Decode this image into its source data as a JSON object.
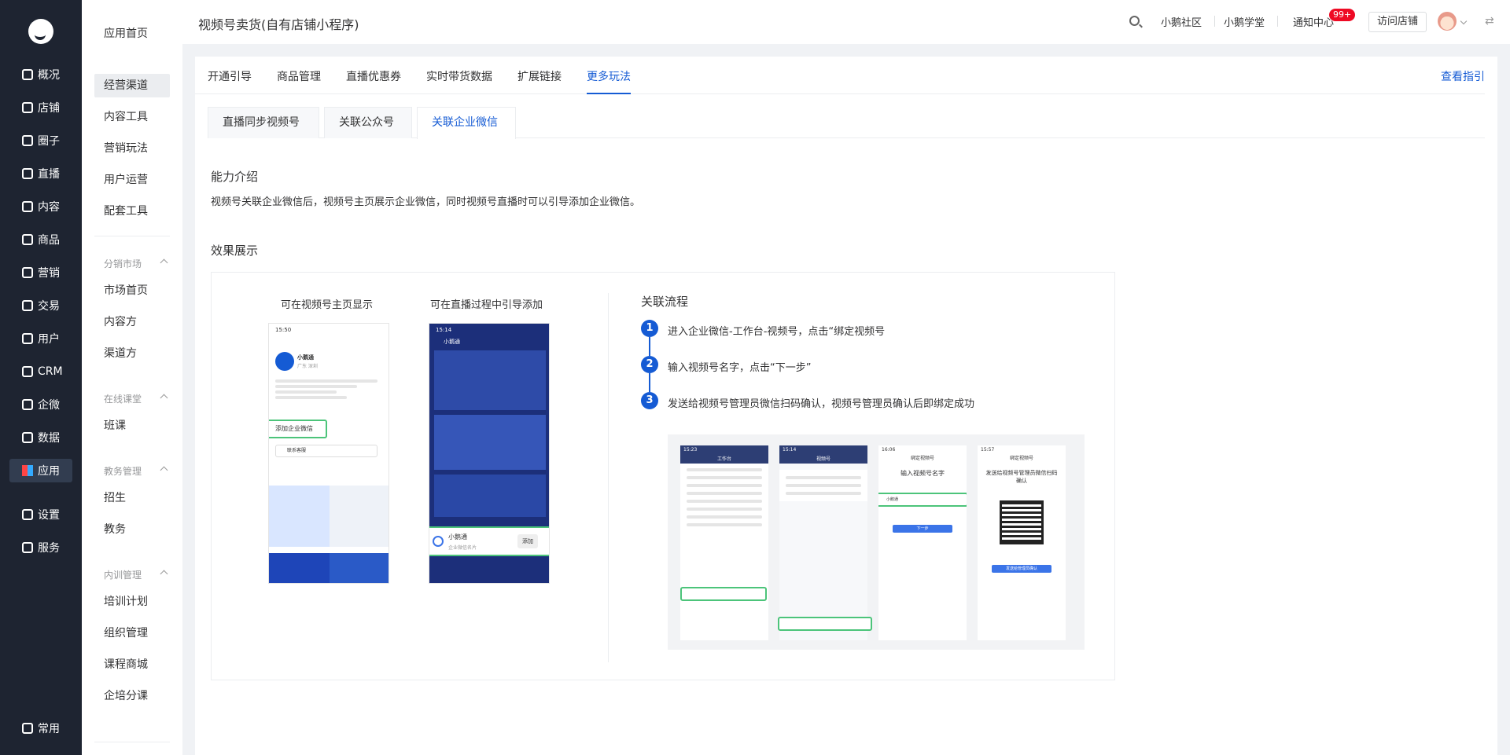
{
  "sidebar": {
    "items": [
      {
        "label": "概况",
        "icon": "overview-icon"
      },
      {
        "label": "店铺",
        "icon": "shop-icon"
      },
      {
        "label": "圈子",
        "icon": "circle-icon"
      },
      {
        "label": "直播",
        "icon": "live-icon"
      },
      {
        "label": "内容",
        "icon": "content-icon"
      },
      {
        "label": "商品",
        "icon": "goods-icon"
      },
      {
        "label": "营销",
        "icon": "marketing-icon"
      },
      {
        "label": "交易",
        "icon": "trade-icon"
      },
      {
        "label": "用户",
        "icon": "user-icon"
      },
      {
        "label": "CRM",
        "icon": "crm-icon"
      },
      {
        "label": "企微",
        "icon": "wecom-icon"
      },
      {
        "label": "数据",
        "icon": "data-icon"
      },
      {
        "label": "应用",
        "icon": "app-icon"
      },
      {
        "label": "设置",
        "icon": "settings-icon"
      },
      {
        "label": "服务",
        "icon": "service-icon"
      }
    ],
    "bottom": {
      "label": "常用",
      "icon": "list-icon"
    }
  },
  "subnav": {
    "home": "应用首页",
    "items": [
      "经营渠道",
      "内容工具",
      "营销玩法",
      "用户运营",
      "配套工具"
    ],
    "groups": [
      {
        "title": "分销市场",
        "items": [
          "市场首页",
          "内容方",
          "渠道方"
        ]
      },
      {
        "title": "在线课堂",
        "items": [
          "班课"
        ]
      },
      {
        "title": "教务管理",
        "items": [
          "招生",
          "教务"
        ]
      },
      {
        "title": "内训管理",
        "items": [
          "培训计划",
          "组织管理",
          "课程商城",
          "企培分课"
        ]
      }
    ]
  },
  "header": {
    "title": "视频号卖货(自有店铺小程序)",
    "links": [
      "小鹅社区",
      "小鹅学堂",
      "通知中心"
    ],
    "badge": "99+",
    "visit_button": "访问店铺"
  },
  "tabs": [
    "开通引导",
    "商品管理",
    "直播优惠券",
    "实时带货数据",
    "扩展链接",
    "更多玩法"
  ],
  "guide_link": "查看指引",
  "subtabs": [
    "直播同步视频号",
    "关联公众号",
    "关联企业微信"
  ],
  "ability": {
    "title": "能力介绍",
    "desc": "视频号关联企业微信后，视频号主页展示企业微信，同时视频号直播时可以引导添加企业微信。"
  },
  "effect": {
    "title": "效果展示",
    "cap_left": "可在视频号主页显示",
    "cap_right": "可在直播过程中引导添加",
    "phone1": {
      "time": "15:50",
      "name": "小鹅通",
      "loc": "广东 深圳",
      "wecom_btn": "添加企业微信",
      "contact": "联系客服"
    },
    "phone2": {
      "time": "15:14",
      "name": "小鹅通",
      "card_name": "小鹅通",
      "card_sub": "企业微信名片",
      "card_btn": "添加"
    }
  },
  "flow": {
    "title": "关联流程",
    "steps": [
      {
        "num": "1",
        "text": "进入企业微信-工作台-视频号，点击“绑定视频号"
      },
      {
        "num": "2",
        "text": "输入视频号名字，点击“下一步”"
      },
      {
        "num": "3",
        "text": "发送给视频号管理员微信扫码确认，视频号管理员确认后即绑定成功"
      }
    ],
    "screens": [
      {
        "time": "15:23",
        "title": "工作台"
      },
      {
        "time": "15:14",
        "title": "视频号"
      },
      {
        "time": "16:06",
        "title": "绑定视频号",
        "heading": "输入视频号名字",
        "input": "小鹅通",
        "button": "下一步"
      },
      {
        "time": "15:57",
        "title": "绑定视频号",
        "heading": "发送给视频号管理员微信扫码确认",
        "button": "发送给管理员确认"
      }
    ]
  }
}
